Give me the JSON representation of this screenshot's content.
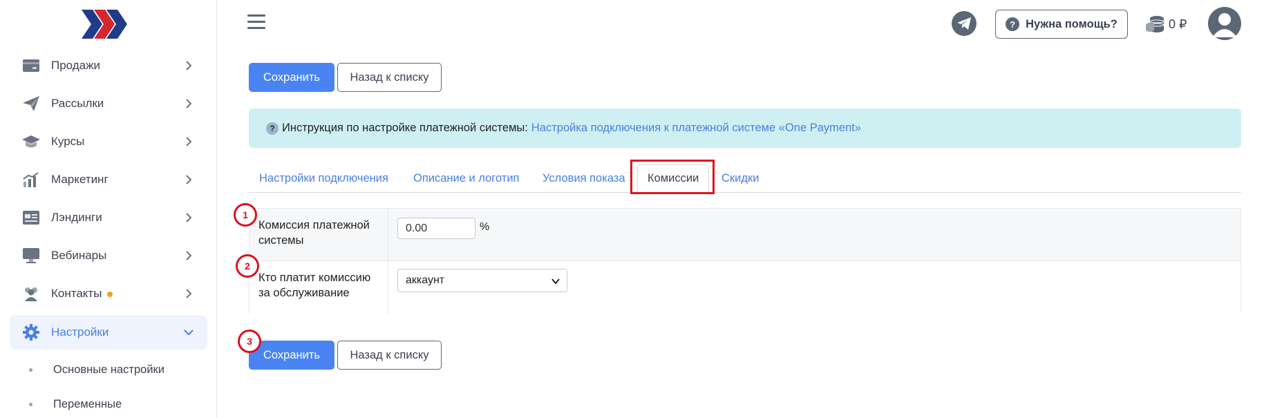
{
  "sidebar": {
    "items": [
      {
        "label": "Продажи",
        "icon": "card-icon"
      },
      {
        "label": "Рассылки",
        "icon": "paper-plane-icon"
      },
      {
        "label": "Курсы",
        "icon": "graduation-cap-icon"
      },
      {
        "label": "Маркетинг",
        "icon": "bar-chart-icon"
      },
      {
        "label": "Лэндинги",
        "icon": "landing-page-icon"
      },
      {
        "label": "Вебинары",
        "icon": "monitor-icon"
      },
      {
        "label": "Контакты",
        "icon": "users-icon"
      },
      {
        "label": "Настройки",
        "icon": "gear-icon"
      }
    ],
    "sub_items": [
      {
        "label": "Основные настройки"
      },
      {
        "label": "Переменные"
      }
    ]
  },
  "header": {
    "help_label": "Нужна помощь?",
    "help_icon_text": "?",
    "balance": "0 ₽"
  },
  "toolbar": {
    "save_label": "Сохранить",
    "back_label": "Назад к списку"
  },
  "alert": {
    "icon_text": "?",
    "text": "Инструкция по настройке платежной системы:",
    "link": "Настройка подключения к платежной системе «One Payment»"
  },
  "tabs": [
    {
      "label": "Настройки подключения"
    },
    {
      "label": "Описание и логотип"
    },
    {
      "label": "Условия показа"
    },
    {
      "label": "Комиссии"
    },
    {
      "label": "Скидки"
    }
  ],
  "form": {
    "commission_label": "Комиссия платежной системы",
    "commission_value": "0.00",
    "commission_unit": "%",
    "payer_label": "Кто платит комиссию за обслуживание",
    "payer_value": "аккаунт"
  },
  "markers": [
    "1",
    "2",
    "3"
  ],
  "colors": {
    "accent": "#4a84f2",
    "alert_bg": "#cff0f3",
    "highlight": "#e0141c"
  }
}
